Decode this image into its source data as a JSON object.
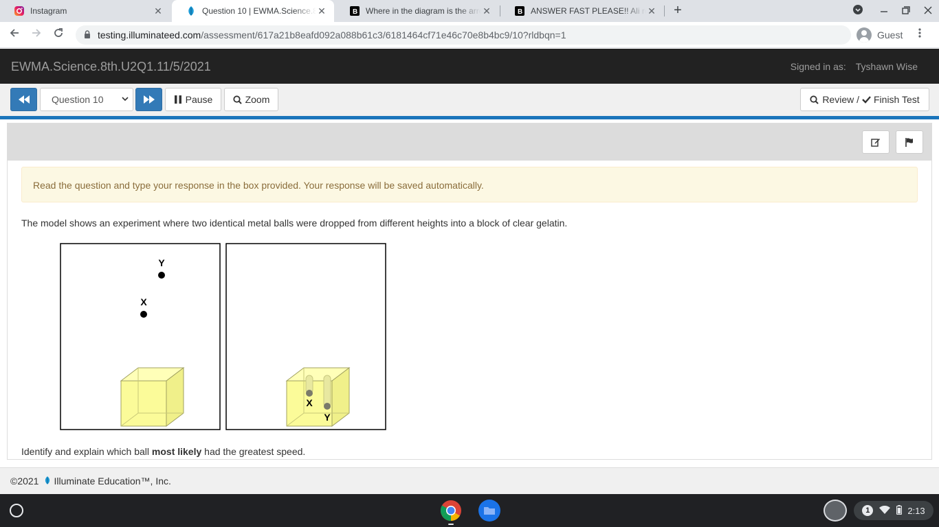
{
  "browser": {
    "tabs": [
      {
        "title": "Instagram",
        "close": "✕"
      },
      {
        "title": "Question 10 | EWMA.Science.8th.U2Q1.11/5/2021",
        "close": "✕"
      },
      {
        "title": "Where in the diagram is the arrow pointing",
        "close": "✕"
      },
      {
        "title": "ANSWER FAST PLEASE!! Ali rolled a ball",
        "close": "✕"
      }
    ],
    "new_tab": "+",
    "url_host": "testing.illuminateed.com",
    "url_path": "/assessment/617a21b8eafd092a088b61c3/6181464cf71e46c70e8b4bc9/10?rldbqn=1",
    "profile": "Guest"
  },
  "app": {
    "title": "EWMA.Science.8th.U2Q1.11/5/2021",
    "signed_in_label": "Signed in as:",
    "user": "Tyshawn Wise"
  },
  "controls": {
    "question_select": "Question 10",
    "pause": "Pause",
    "zoom": "Zoom",
    "review": "Review /",
    "finish": "Finish Test"
  },
  "question": {
    "notice": "Read the question and type your response in the box provided. Your response will be saved automatically.",
    "text": "The model shows an experiment where two identical metal balls were dropped from different heights into a block of clear gelatin.",
    "prompt_before": "Identify and explain which ball ",
    "prompt_bold": "most likely",
    "prompt_after": " had the greatest speed.",
    "figure": {
      "label_y": "Y",
      "label_x": "X",
      "label_x2": "X",
      "label_y2": "Y"
    }
  },
  "footer": {
    "copyright": "©2021",
    "company": "Illuminate Education™, Inc."
  },
  "system": {
    "notifications": "1",
    "time": "2:13"
  }
}
